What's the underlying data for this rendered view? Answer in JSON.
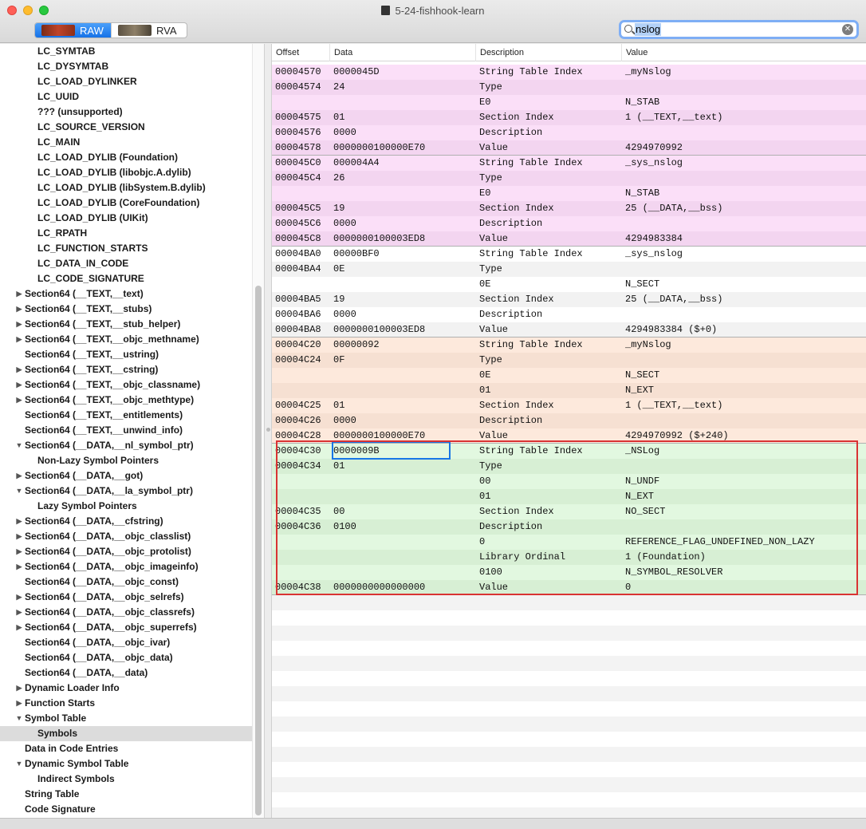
{
  "window": {
    "title": "5-24-fishhook-learn"
  },
  "toolbar": {
    "raw_label": "RAW",
    "rva_label": "RVA",
    "selected_mode": "RAW",
    "search_value": "nslog"
  },
  "colors": {
    "pink_a": "#fbdff8",
    "pink_b": "#f3d5f0",
    "white_a": "#ffffff",
    "white_b": "#f2f2f2",
    "peach_a": "#fde9dc",
    "peach_b": "#f6e0d2",
    "green_a": "#e2f8e0",
    "green_b": "#d7efd4",
    "annotation": "#d93333",
    "focus": "#1876e6"
  },
  "sidebar": {
    "items": [
      {
        "label": "LC_SYMTAB",
        "indent": 1,
        "disclosure": ""
      },
      {
        "label": "LC_DYSYMTAB",
        "indent": 1,
        "disclosure": ""
      },
      {
        "label": "LC_LOAD_DYLINKER",
        "indent": 1,
        "disclosure": ""
      },
      {
        "label": "LC_UUID",
        "indent": 1,
        "disclosure": ""
      },
      {
        "label": "??? (unsupported)",
        "indent": 1,
        "disclosure": ""
      },
      {
        "label": "LC_SOURCE_VERSION",
        "indent": 1,
        "disclosure": ""
      },
      {
        "label": "LC_MAIN",
        "indent": 1,
        "disclosure": ""
      },
      {
        "label": "LC_LOAD_DYLIB (Foundation)",
        "indent": 1,
        "disclosure": ""
      },
      {
        "label": "LC_LOAD_DYLIB (libobjc.A.dylib)",
        "indent": 1,
        "disclosure": ""
      },
      {
        "label": "LC_LOAD_DYLIB (libSystem.B.dylib)",
        "indent": 1,
        "disclosure": ""
      },
      {
        "label": "LC_LOAD_DYLIB (CoreFoundation)",
        "indent": 1,
        "disclosure": ""
      },
      {
        "label": "LC_LOAD_DYLIB (UIKit)",
        "indent": 1,
        "disclosure": ""
      },
      {
        "label": "LC_RPATH",
        "indent": 1,
        "disclosure": ""
      },
      {
        "label": "LC_FUNCTION_STARTS",
        "indent": 1,
        "disclosure": ""
      },
      {
        "label": "LC_DATA_IN_CODE",
        "indent": 1,
        "disclosure": ""
      },
      {
        "label": "LC_CODE_SIGNATURE",
        "indent": 1,
        "disclosure": ""
      },
      {
        "label": "Section64 (__TEXT,__text)",
        "indent": 0,
        "disclosure": "collapsed"
      },
      {
        "label": "Section64 (__TEXT,__stubs)",
        "indent": 0,
        "disclosure": "collapsed"
      },
      {
        "label": "Section64 (__TEXT,__stub_helper)",
        "indent": 0,
        "disclosure": "collapsed"
      },
      {
        "label": "Section64 (__TEXT,__objc_methname)",
        "indent": 0,
        "disclosure": "collapsed"
      },
      {
        "label": "Section64 (__TEXT,__ustring)",
        "indent": 0,
        "disclosure": ""
      },
      {
        "label": "Section64 (__TEXT,__cstring)",
        "indent": 0,
        "disclosure": "collapsed"
      },
      {
        "label": "Section64 (__TEXT,__objc_classname)",
        "indent": 0,
        "disclosure": "collapsed"
      },
      {
        "label": "Section64 (__TEXT,__objc_methtype)",
        "indent": 0,
        "disclosure": "collapsed"
      },
      {
        "label": "Section64 (__TEXT,__entitlements)",
        "indent": 0,
        "disclosure": ""
      },
      {
        "label": "Section64 (__TEXT,__unwind_info)",
        "indent": 0,
        "disclosure": ""
      },
      {
        "label": "Section64 (__DATA,__nl_symbol_ptr)",
        "indent": 0,
        "disclosure": "expanded"
      },
      {
        "label": "Non-Lazy Symbol Pointers",
        "indent": 1,
        "disclosure": ""
      },
      {
        "label": "Section64 (__DATA,__got)",
        "indent": 0,
        "disclosure": "collapsed"
      },
      {
        "label": "Section64 (__DATA,__la_symbol_ptr)",
        "indent": 0,
        "disclosure": "expanded"
      },
      {
        "label": "Lazy Symbol Pointers",
        "indent": 1,
        "disclosure": ""
      },
      {
        "label": "Section64 (__DATA,__cfstring)",
        "indent": 0,
        "disclosure": "collapsed"
      },
      {
        "label": "Section64 (__DATA,__objc_classlist)",
        "indent": 0,
        "disclosure": "collapsed"
      },
      {
        "label": "Section64 (__DATA,__objc_protolist)",
        "indent": 0,
        "disclosure": "collapsed"
      },
      {
        "label": "Section64 (__DATA,__objc_imageinfo)",
        "indent": 0,
        "disclosure": "collapsed"
      },
      {
        "label": "Section64 (__DATA,__objc_const)",
        "indent": 0,
        "disclosure": ""
      },
      {
        "label": "Section64 (__DATA,__objc_selrefs)",
        "indent": 0,
        "disclosure": "collapsed"
      },
      {
        "label": "Section64 (__DATA,__objc_classrefs)",
        "indent": 0,
        "disclosure": "collapsed"
      },
      {
        "label": "Section64 (__DATA,__objc_superrefs)",
        "indent": 0,
        "disclosure": "collapsed"
      },
      {
        "label": "Section64 (__DATA,__objc_ivar)",
        "indent": 0,
        "disclosure": ""
      },
      {
        "label": "Section64 (__DATA,__objc_data)",
        "indent": 0,
        "disclosure": ""
      },
      {
        "label": "Section64 (__DATA,__data)",
        "indent": 0,
        "disclosure": ""
      },
      {
        "label": "Dynamic Loader Info",
        "indent": 0,
        "disclosure": "collapsed"
      },
      {
        "label": "Function Starts",
        "indent": 0,
        "disclosure": "collapsed"
      },
      {
        "label": "Symbol Table",
        "indent": 0,
        "disclosure": "expanded"
      },
      {
        "label": "Symbols",
        "indent": 1,
        "disclosure": "",
        "selected": true
      },
      {
        "label": "Data in Code Entries",
        "indent": 0,
        "disclosure": ""
      },
      {
        "label": "Dynamic Symbol Table",
        "indent": 0,
        "disclosure": "expanded"
      },
      {
        "label": "Indirect Symbols",
        "indent": 1,
        "disclosure": ""
      },
      {
        "label": "String Table",
        "indent": 0,
        "disclosure": ""
      },
      {
        "label": "Code Signature",
        "indent": 0,
        "disclosure": ""
      }
    ]
  },
  "table": {
    "columns": [
      "Offset",
      "Data",
      "Description",
      "Value"
    ],
    "groups": [
      {
        "color": "pink",
        "rows": [
          [
            "00004570",
            "0000045D",
            "String Table Index",
            "_myNslog"
          ],
          [
            "00004574",
            "24",
            "Type",
            ""
          ],
          [
            "",
            "",
            "E0",
            "N_STAB"
          ],
          [
            "00004575",
            "01",
            "Section Index",
            "1 (__TEXT,__text)"
          ],
          [
            "00004576",
            "0000",
            "Description",
            ""
          ],
          [
            "00004578",
            "0000000100000E70",
            "Value",
            "4294970992"
          ]
        ]
      },
      {
        "color": "pink",
        "rows": [
          [
            "000045C0",
            "000004A4",
            "String Table Index",
            "_sys_nslog"
          ],
          [
            "000045C4",
            "26",
            "Type",
            ""
          ],
          [
            "",
            "",
            "E0",
            "N_STAB"
          ],
          [
            "000045C5",
            "19",
            "Section Index",
            "25 (__DATA,__bss)"
          ],
          [
            "000045C6",
            "0000",
            "Description",
            ""
          ],
          [
            "000045C8",
            "0000000100003ED8",
            "Value",
            "4294983384"
          ]
        ]
      },
      {
        "color": "white",
        "rows": [
          [
            "00004BA0",
            "00000BF0",
            "String Table Index",
            "_sys_nslog"
          ],
          [
            "00004BA4",
            "0E",
            "Type",
            ""
          ],
          [
            "",
            "",
            "0E",
            "N_SECT"
          ],
          [
            "00004BA5",
            "19",
            "Section Index",
            "25 (__DATA,__bss)"
          ],
          [
            "00004BA6",
            "0000",
            "Description",
            ""
          ],
          [
            "00004BA8",
            "0000000100003ED8",
            "Value",
            "4294983384 ($+0)"
          ]
        ]
      },
      {
        "color": "peach",
        "rows": [
          [
            "00004C20",
            "00000092",
            "String Table Index",
            "_myNslog"
          ],
          [
            "00004C24",
            "0F",
            "Type",
            ""
          ],
          [
            "",
            "",
            "0E",
            "N_SECT"
          ],
          [
            "",
            "",
            "01",
            "N_EXT"
          ],
          [
            "00004C25",
            "01",
            "Section Index",
            "1 (__TEXT,__text)"
          ],
          [
            "00004C26",
            "0000",
            "Description",
            ""
          ],
          [
            "00004C28",
            "0000000100000E70",
            "Value",
            "4294970992 ($+240)"
          ]
        ]
      },
      {
        "color": "green",
        "rows": [
          [
            "00004C30",
            "0000009B",
            "String Table Index",
            "_NSLog"
          ],
          [
            "00004C34",
            "01",
            "Type",
            ""
          ],
          [
            "",
            "",
            "00",
            "N_UNDF"
          ],
          [
            "",
            "",
            "01",
            "N_EXT"
          ],
          [
            "00004C35",
            "00",
            "Section Index",
            "NO_SECT"
          ],
          [
            "00004C36",
            "0100",
            "Description",
            ""
          ],
          [
            "",
            "",
            "0",
            "REFERENCE_FLAG_UNDEFINED_NON_LAZY"
          ],
          [
            "",
            "",
            "Library Ordinal",
            "1 (Foundation)"
          ],
          [
            "",
            "",
            "0100",
            "N_SYMBOL_RESOLVER"
          ],
          [
            "00004C38",
            "0000000000000000",
            "Value",
            "0"
          ]
        ]
      }
    ]
  }
}
